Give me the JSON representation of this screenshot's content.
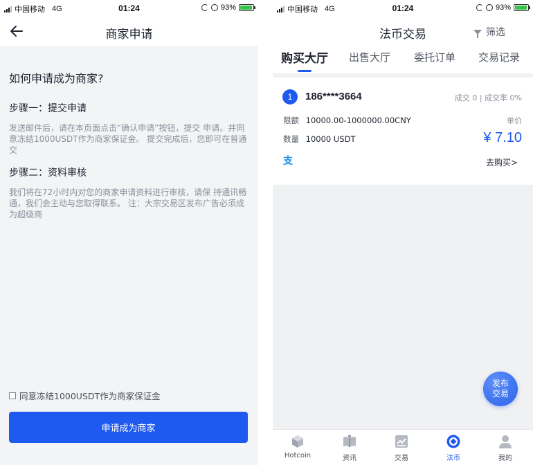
{
  "status_bar": {
    "carrier": "中国移动",
    "network": "4G",
    "time": "01:24",
    "battery": "93%"
  },
  "left": {
    "nav_title": "商家申请",
    "question": "如何申请成为商家?",
    "steps": [
      {
        "title": "步骤一：提交申请",
        "body": "发送邮件后，请在本页面点击“确认申请”按钮，提交 申请。并同意冻结1000USDT作为商家保证金。 提交完成后，您即可在普通交"
      },
      {
        "title": "步骤二：资料审核",
        "body": "我们将在72小时内对您的商家申请资料进行审核，请保 持通讯畅通，我们会主动与您取得联系。 注：大宗交易区发布广告必须成为超级商"
      }
    ],
    "agree_label": "同意冻结1000USDT作为商家保证金",
    "apply_button": "申请成为商家"
  },
  "right": {
    "title": "法币交易",
    "filter_label": "筛选",
    "tabs": [
      "购买大厅",
      "出售大厅",
      "委托订单",
      "交易记录"
    ],
    "active_tab": 0,
    "card": {
      "rank": "1",
      "user": "186****3664",
      "stats": "成交 0 | 成交率 0%",
      "limit_label": "限额",
      "limit_value": "10000.00-1000000.00CNY",
      "qty_label": "数量",
      "qty_value": "10000 USDT",
      "price_label": "单价",
      "price": "¥ 7.10",
      "pay_icon": "支",
      "buy_link": "去购买>"
    },
    "fab_line1": "发布",
    "fab_line2": "交易",
    "tabbar": [
      {
        "label": "Hotcoin",
        "icon": "cube-icon"
      },
      {
        "label": "资讯",
        "icon": "book-icon"
      },
      {
        "label": "交易",
        "icon": "chart-icon"
      },
      {
        "label": "法币",
        "icon": "fiat-icon"
      },
      {
        "label": "我的",
        "icon": "user-icon"
      }
    ],
    "active_tabbar": 3
  },
  "colors": {
    "accent": "#1f5af0",
    "muted": "#8a8f99",
    "background": "#f3f4f6"
  }
}
